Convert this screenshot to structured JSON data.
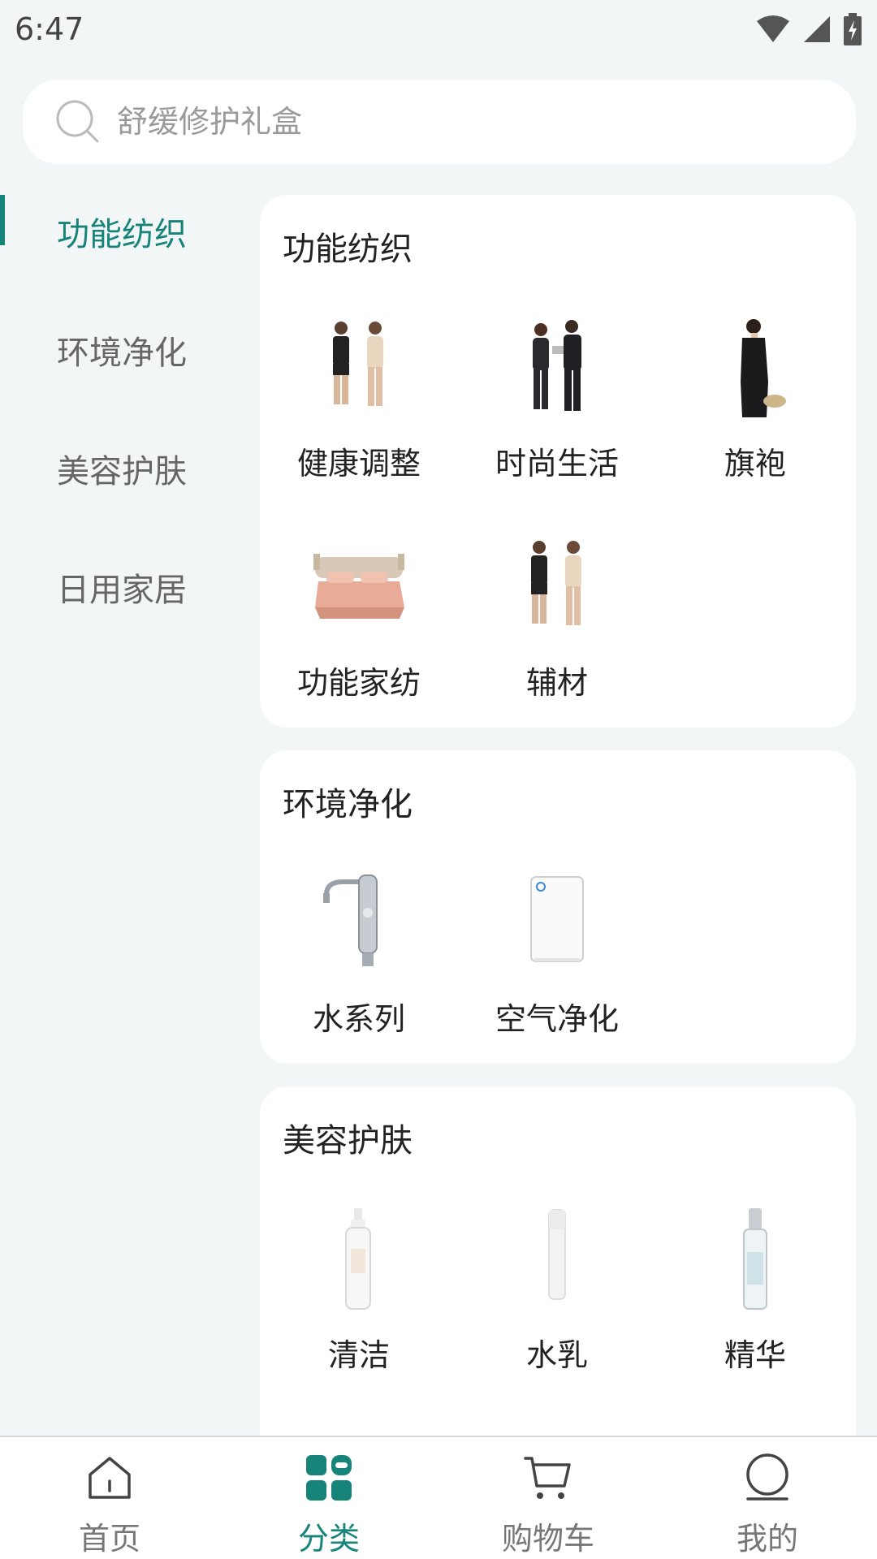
{
  "status_bar": {
    "time": "6:47"
  },
  "search": {
    "placeholder": "舒缓修护礼盒",
    "icon": "search-icon"
  },
  "sidebar": {
    "items": [
      {
        "label": "功能纺织",
        "active": true
      },
      {
        "label": "环境净化",
        "active": false
      },
      {
        "label": "美容护肤",
        "active": false
      },
      {
        "label": "日用家居",
        "active": false
      }
    ]
  },
  "sections": [
    {
      "title": "功能纺织",
      "items": [
        {
          "label": "健康调整",
          "image": "body-shaping-wear"
        },
        {
          "label": "时尚生活",
          "image": "couple-thermal-wear"
        },
        {
          "label": "旗袍",
          "image": "qipao-dress"
        },
        {
          "label": "功能家纺",
          "image": "bedding-set"
        },
        {
          "label": "辅材",
          "image": "body-shaping-wear"
        }
      ]
    },
    {
      "title": "环境净化",
      "items": [
        {
          "label": "水系列",
          "image": "water-faucet-filter"
        },
        {
          "label": "空气净化",
          "image": "air-purifier"
        }
      ]
    },
    {
      "title": "美容护肤",
      "items": [
        {
          "label": "清洁",
          "image": "cleanser-bottle"
        },
        {
          "label": "水乳",
          "image": "lotion-bottle"
        },
        {
          "label": "精华",
          "image": "serum-bottle"
        }
      ]
    }
  ],
  "bottom_nav": {
    "items": [
      {
        "label": "首页",
        "icon": "home-icon",
        "active": false
      },
      {
        "label": "分类",
        "icon": "category-icon",
        "active": true
      },
      {
        "label": "购物车",
        "icon": "cart-icon",
        "active": false
      },
      {
        "label": "我的",
        "icon": "profile-icon",
        "active": false
      }
    ]
  },
  "colors": {
    "accent": "#17847a",
    "background": "#f3f6f7",
    "card": "#ffffff"
  }
}
